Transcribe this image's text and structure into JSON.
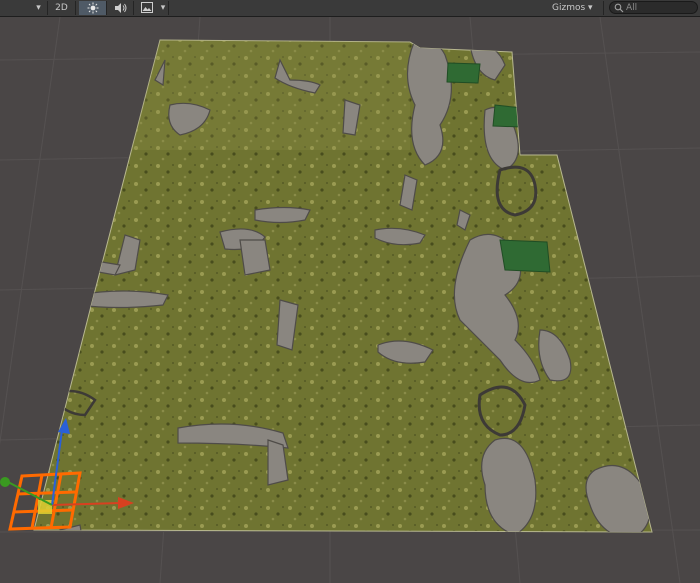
{
  "toolbar": {
    "dropdown_arrow": "▾",
    "mode_2d_label": "2D",
    "lighting_icon": "sun-icon",
    "audio_icon": "speaker-icon",
    "effects_icon": "image-icon",
    "gizmos_label": "Gizmos",
    "gizmos_arrow": "▾",
    "search_placeholder": "All"
  },
  "colors": {
    "toolbar_bg": "#3a3a3a",
    "scene_bg": "#4a4646",
    "grid_line": "#5a5656",
    "terrain": "#6f7431",
    "terrain_highlight": "#a5a55a",
    "rock": "#8a8680",
    "grass_patch": "#2f6a33",
    "selection": "#ff6a00",
    "axis_x": "#d84020",
    "axis_y": "#3a9a20",
    "axis_z": "#2a60d8"
  }
}
